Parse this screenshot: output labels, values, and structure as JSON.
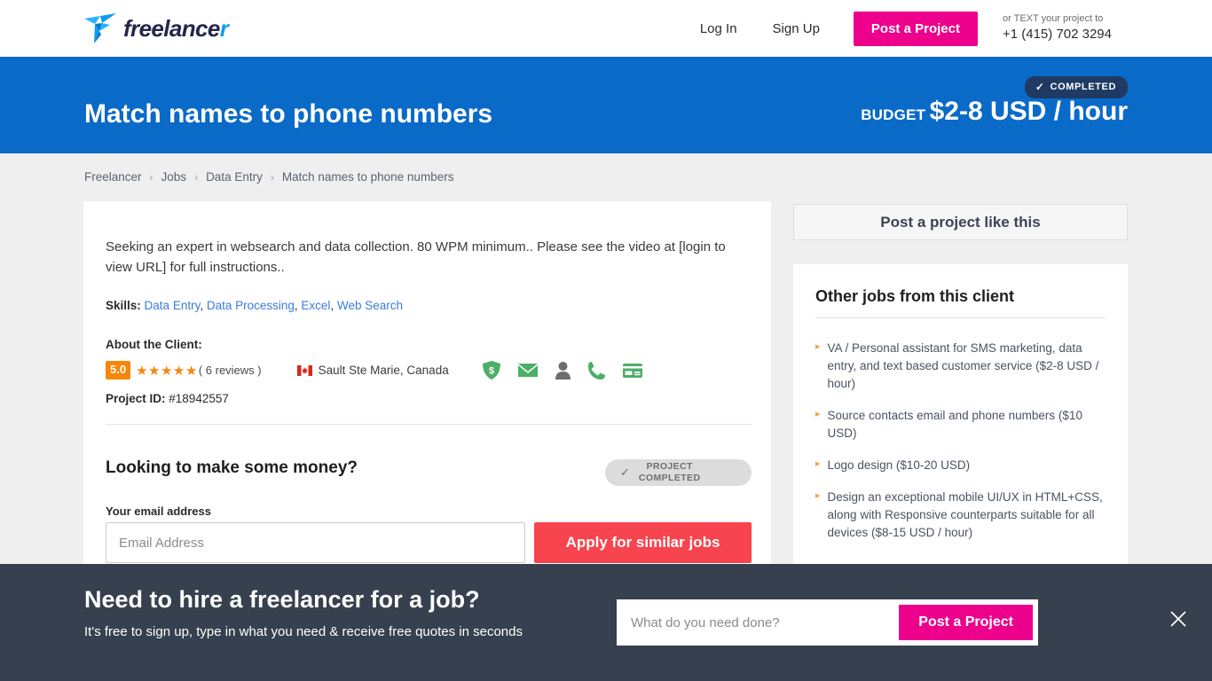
{
  "header": {
    "logo_text": "freelance",
    "logo_tail": "r",
    "login_label": "Log In",
    "signup_label": "Sign Up",
    "post_project_label": "Post a Project",
    "text_hint": "or TEXT your project to",
    "phone": "+1 (415) 702 3294"
  },
  "hero": {
    "title": "Match names to phone numbers",
    "budget_label": "BUDGET",
    "budget_amount": "$2-8 USD / hour",
    "status_badge": "COMPLETED",
    "status_check": "✓",
    "bg_color": "#0a6ac8",
    "badge_color": "#1f3a63"
  },
  "breadcrumb": {
    "items": [
      {
        "label": "Freelancer"
      },
      {
        "label": "Jobs"
      },
      {
        "label": "Data Entry"
      },
      {
        "label": "Match names to phone numbers"
      }
    ],
    "separator": "›"
  },
  "project": {
    "description": "Seeking an expert in websearch and data collection. 80 WPM minimum.. Please see the video at [login to view URL] for full instructions..",
    "skills_label": "Skills:",
    "skills": [
      "Data Entry",
      "Data Processing",
      "Excel",
      "Web Search"
    ],
    "about_client_label": "About the Client:",
    "rating": "5.0",
    "stars": "★★★★★",
    "reviews": "( 6 reviews )",
    "location": "Sault Ste Marie, Canada",
    "verifications": [
      "payment-verified-shield-icon",
      "email-verified-icon",
      "identity-unverified-person-icon",
      "phone-verified-icon",
      "payment-method-verified-icon"
    ],
    "project_id_label": "Project ID:",
    "project_id": "#18942557",
    "rating_color": "#f5870a"
  },
  "apply_section": {
    "heading": "Looking to make some money?",
    "status_check": "✓",
    "status_line1": "PROJECT",
    "status_line2": "COMPLETED",
    "email_label": "Your email address",
    "email_value": "",
    "email_placeholder": "Email Address",
    "apply_button": "Apply for similar jobs",
    "apply_color": "#f7444e"
  },
  "sidebar": {
    "post_like_this": "Post a project like this",
    "other_jobs_title": "Other jobs from this client",
    "bullet": "▸",
    "jobs": [
      "VA / Personal assistant for SMS marketing, data entry, and text based customer service ($2-8 USD / hour)",
      "Source contacts email and phone numbers ($10 USD)",
      "Logo design ($10-20 USD)",
      "Design an exceptional mobile UI/UX in HTML+CSS, along with Responsive counterparts suitable for all devices ($8-15 USD / hour)"
    ]
  },
  "bottom_banner": {
    "title": "Need to hire a freelancer for a job?",
    "subtitle": "It's free to sign up, type in what you need & receive free quotes in seconds",
    "search_value": "",
    "search_placeholder": "What do you need done?",
    "post_button": "Post a Project",
    "close_icon": "close-icon",
    "bg_color": "#36404e",
    "accent_color": "#ec008c"
  }
}
